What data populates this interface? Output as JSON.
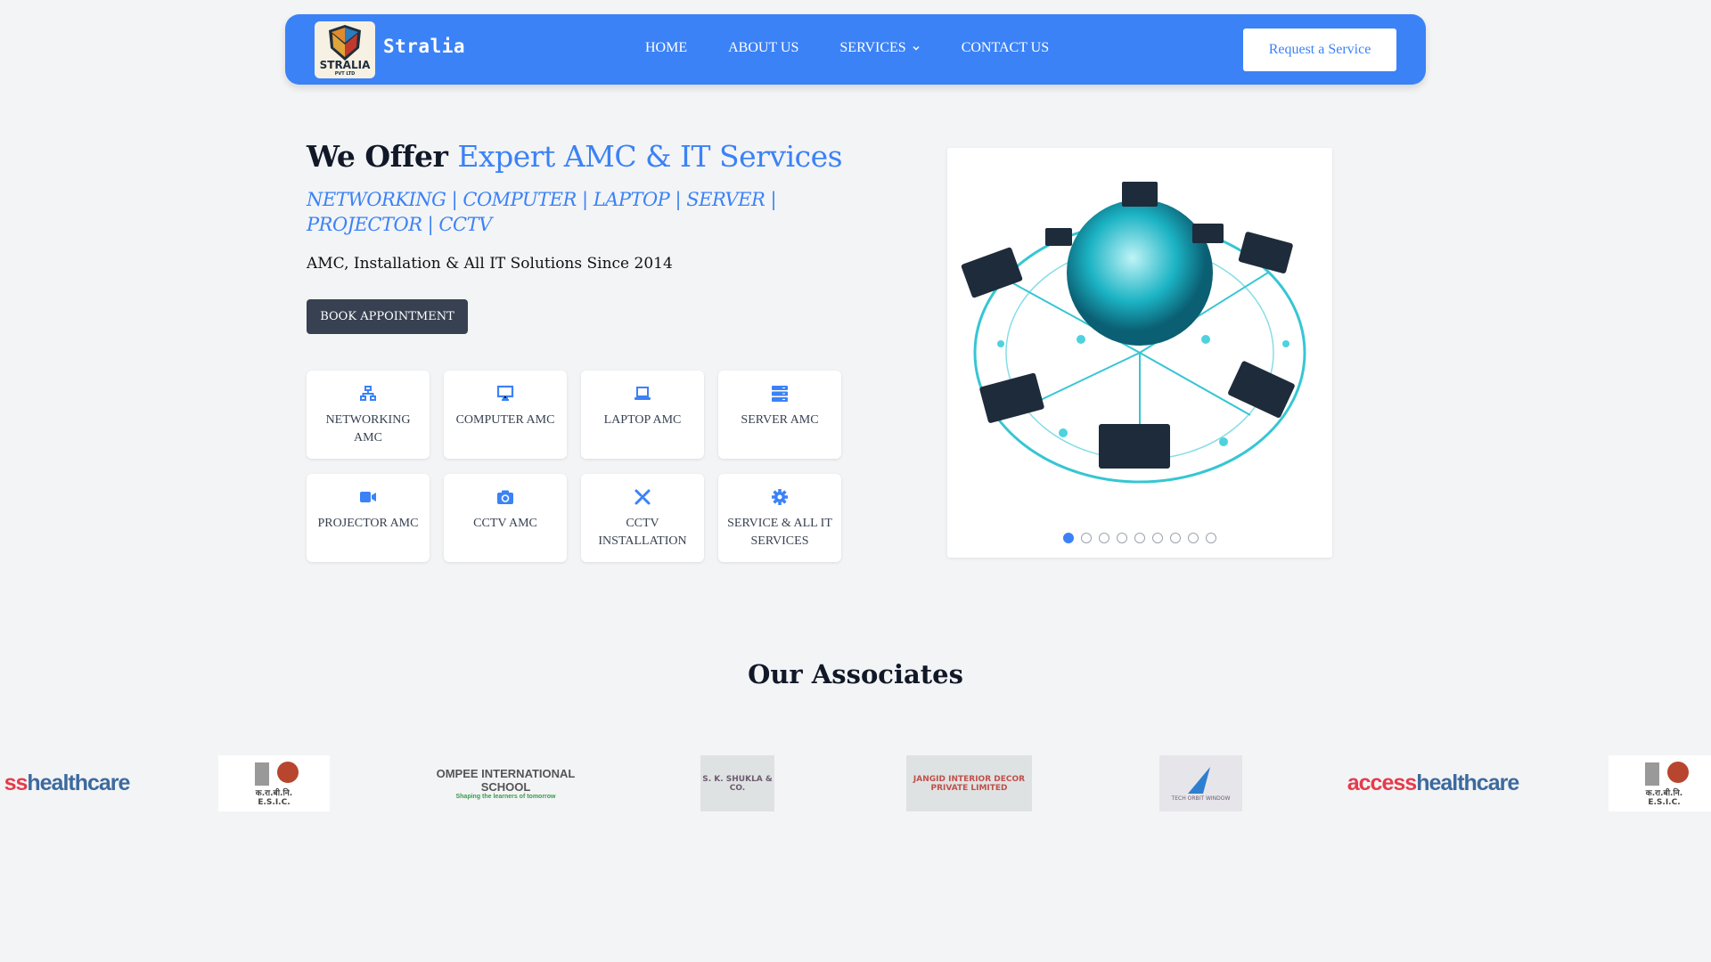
{
  "header": {
    "logo_text": "STRALIA",
    "logo_sub": "PVT LTD",
    "brand": "Stralia",
    "nav": [
      "HOME",
      "ABOUT US",
      "SERVICES",
      "CONTACT US"
    ],
    "cta": "Request a Service"
  },
  "hero": {
    "title_plain": "We Offer",
    "title_highlight": "Expert AMC & IT Services",
    "subtitle": "NETWORKING | COMPUTER | LAPTOP | SERVER | PROJECTOR | CCTV",
    "since": "AMC, Installation & All IT Solutions Since 2014",
    "button": "BOOK APPOINTMENT"
  },
  "services": [
    {
      "label": "NETWORKING AMC",
      "icon": "network-icon"
    },
    {
      "label": "COMPUTER AMC",
      "icon": "desktop-icon"
    },
    {
      "label": "LAPTOP AMC",
      "icon": "laptop-icon"
    },
    {
      "label": "SERVER AMC",
      "icon": "server-icon"
    },
    {
      "label": "PROJECTOR AMC",
      "icon": "video-camera-icon"
    },
    {
      "label": "CCTV AMC",
      "icon": "camera-icon"
    },
    {
      "label": "CCTV INSTALLATION",
      "icon": "tools-icon"
    },
    {
      "label": "SERVICE & ALL IT SERVICES",
      "icon": "gear-icon"
    }
  ],
  "carousel": {
    "slides": 9,
    "active": 1
  },
  "associates": {
    "title": "Our Associates",
    "logos": [
      {
        "a": "ss",
        "b": "healthcare"
      },
      {
        "name": "E.S.I.C.",
        "sub": "क.रा.बी.नि."
      },
      {
        "name": "OMPEE INTERNATIONAL SCHOOL",
        "tag": "Shaping the learners of tomorrow"
      },
      {
        "name": "S. K. SHUKLA & CO."
      },
      {
        "name": "JANGID INTERIOR DECOR PRIVATE LIMITED"
      },
      {
        "name": "TECH ORBIT WINDOW"
      },
      {
        "a": "access",
        "b": "healthcare"
      },
      {
        "name": "E.S.I.C.",
        "sub": "क.रा.बी.नि."
      }
    ]
  },
  "colors": {
    "primary": "#3b82f6",
    "dark": "#374151",
    "bg": "#f3f4f6"
  }
}
